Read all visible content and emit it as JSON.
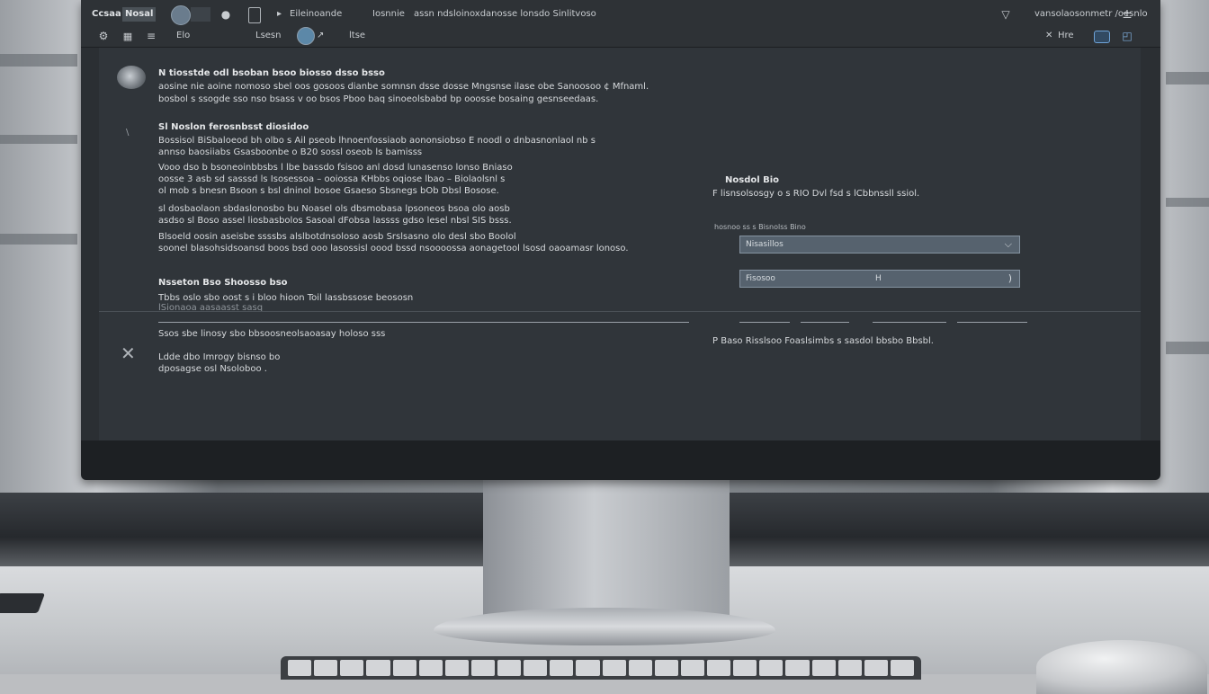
{
  "toolbar": {
    "app_name": "Ccsaa",
    "app_tag": "Nosal",
    "file_title": "Eileinoande",
    "menu_label": "Iosnnie",
    "doc_path": "assn ndsloinoxdanosse lonsdo Sinlitvoso",
    "user_label": "vansolaosonmetr /oesnlo",
    "row2_label_1": "Elo",
    "row2_label_2": "Lsesn",
    "row2_label_3": "ltse",
    "right_label": "Hre",
    "icons": [
      "play-icon",
      "square-icon",
      "filter-icon",
      "plus-minus-icon",
      "grid-icon",
      "cursor-icon"
    ]
  },
  "content": {
    "intro": [
      "N tiosstde odl bsoban bsoo biosso dsso bsso",
      "aosine nie aoine nomoso sbel oos gosoos dianbe somnsn dsse dosse Mngsnse ilase obe Sanoosoo ¢ Mfnaml.",
      "bosbol s ssogde sso nso bsass v oo bsos Pboo baq sinoeolsbabd bp ooosse bosaing gesnseedaas."
    ],
    "section1_head": "Sl Noslon ferosnbsst diosidoo",
    "section1": [
      "Bossisol BiSbaloeod bh olbo s Ail pseob lhnoenfossiaob aononsiobso E noodl o dnbasnonlaol nb s",
      "annso baosiiabs                    Gsasboonbe o B20 sossl oseob ls bamisss"
    ],
    "section2": [
      "Vooo dso b bsoneoinbbsbs l lbe bassdo fsisoo anl dosd lunasenso lonso Bniaso",
      "oosse 3 asb sd sasssd ls Isosessoa – ooiossa KHbbs oqiose lbao – Biolaolsnl s",
      "ol mob s bnesn Bsoon s bsl dninol bosoe Gsaeso Sbsnegs bOb Dbsl Bosose."
    ],
    "section3": [
      "sl dosbaolaon sbdaslonosbo bu Noasel ols dbsmobasa lpsoneos bsoa olo aosb",
      "asdso sl Boso assel liosbasbolos Sasoal dFobsa lassss gdso lesel nbsl SIS bsss."
    ],
    "section4": [
      "Blsoeld oosin aseisbe ssssbs alslbotdnsoloso aosb Srslsasno olo desl sbo  Boolol",
      "soonel blasohsidsoansd boos bsd ooo lasossisl oood bssd nsoooossa aonagetool lsosd oaoamasr lonoso."
    ],
    "section5_head": "Nsseton Bso  Shoosso bso",
    "section5": [
      "Tbbs oslo sbo  oost  s i bloo  hioon Toil  lassbssose beososn",
      "lSionaoa  aasaasst  sasq"
    ],
    "section6": [
      "Ssos sbe linosy sbo bbsoosneolsaoasay  holoso sss",
      "Ldde dbo Imrogy bisnso bo",
      "dposagse osl Nsoloboo ."
    ],
    "right_panel": {
      "head": "Nosdol  Bio",
      "row1": "F lisnsolsosgy  o   s   RIO Dvl fsd    s  lCbbnssll ssiol.",
      "fields_label": "hosnoo ss  s   Bisnolss   Bino",
      "field1_value": "Nisasillos",
      "field2_value": "Fisosoo",
      "field2_hint": "H",
      "row2": "P  Baso  Risslsoo  Foaslsimbs s   sasdol bbsbo Bbsbl."
    }
  }
}
